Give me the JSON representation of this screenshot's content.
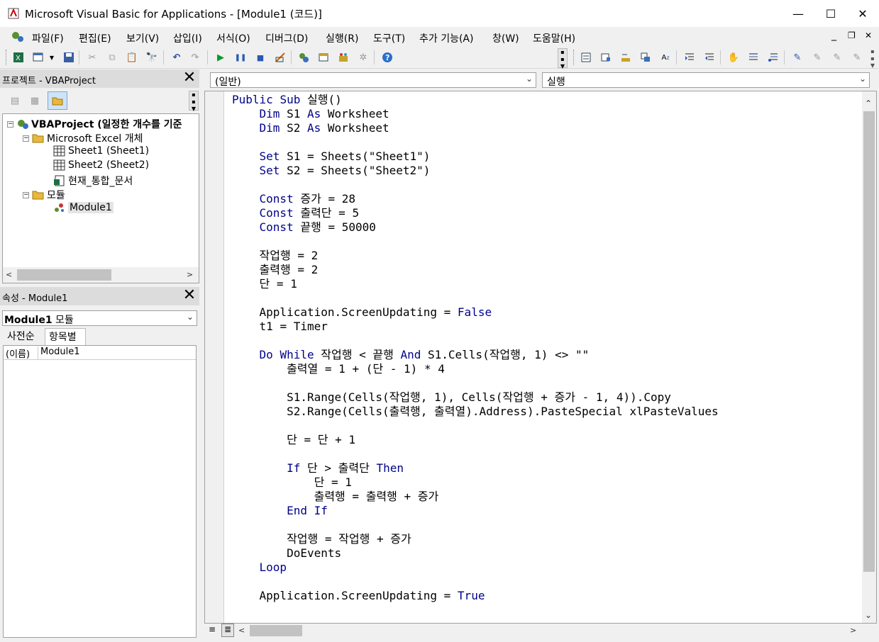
{
  "window": {
    "title": "Microsoft Visual Basic for Applications - [Module1 (코드)]",
    "minimize": "—",
    "maximize": "☐",
    "close": "✕",
    "child_min": "_",
    "child_restore": "❐",
    "child_close": "✕"
  },
  "menu": [
    "파일(F)",
    "편집(E)",
    "보기(V)",
    "삽입(I)",
    "서식(O)",
    "디버그(D)",
    "실행(R)",
    "도구(T)",
    "추가 기능(A)",
    "창(W)",
    "도움말(H)"
  ],
  "project_panel": {
    "title": "프로젝트 - VBAProject",
    "close": "✕",
    "tree": {
      "root": "VBAProject (일정한 개수를 기준",
      "excel_objects": "Microsoft Excel 개체",
      "sheet1": "Sheet1 (Sheet1)",
      "sheet2": "Sheet2 (Sheet2)",
      "workbook": "현재_통합_문서",
      "modules": "모듈",
      "module1": "Module1"
    }
  },
  "properties_panel": {
    "title": "속성 - Module1",
    "close": "✕",
    "object_name": "Module1",
    "object_type": "모듈",
    "tabs": [
      "사전순",
      "항목별"
    ],
    "rows": [
      {
        "name": "(이름)",
        "value": "Module1"
      }
    ]
  },
  "code_window": {
    "object_combo": "(일반)",
    "proc_combo": "실행",
    "lines": [
      "Public Sub 실행()",
      "    Dim S1 As Worksheet",
      "    Dim S2 As Worksheet",
      "",
      "    Set S1 = Sheets(\"Sheet1\")",
      "    Set S2 = Sheets(\"Sheet2\")",
      "",
      "    Const 증가 = 28",
      "    Const 출력단 = 5",
      "    Const 끝행 = 50000",
      "",
      "    작업행 = 2",
      "    출력행 = 2",
      "    단 = 1",
      "",
      "    Application.ScreenUpdating = False",
      "    t1 = Timer",
      "",
      "    Do While 작업행 < 끝행 And S1.Cells(작업행, 1) <> \"\"",
      "        출력열 = 1 + (단 - 1) * 4",
      "",
      "        S1.Range(Cells(작업행, 1), Cells(작업행 + 증가 - 1, 4)).Copy",
      "        S2.Range(Cells(출력행, 출력열).Address).PasteSpecial xlPasteValues",
      "",
      "        단 = 단 + 1",
      "",
      "        If 단 > 출력단 Then",
      "            단 = 1",
      "            출력행 = 출력행 + 증가",
      "        End If",
      "",
      "        작업행 = 작업행 + 증가",
      "        DoEvents",
      "    Loop",
      "",
      "    Application.ScreenUpdating = True"
    ],
    "keywords": [
      "Public",
      "Sub",
      "Dim",
      "As",
      "Set",
      "Const",
      "Do",
      "While",
      "And",
      "If",
      "Then",
      "End",
      "Loop",
      "False",
      "True"
    ]
  }
}
